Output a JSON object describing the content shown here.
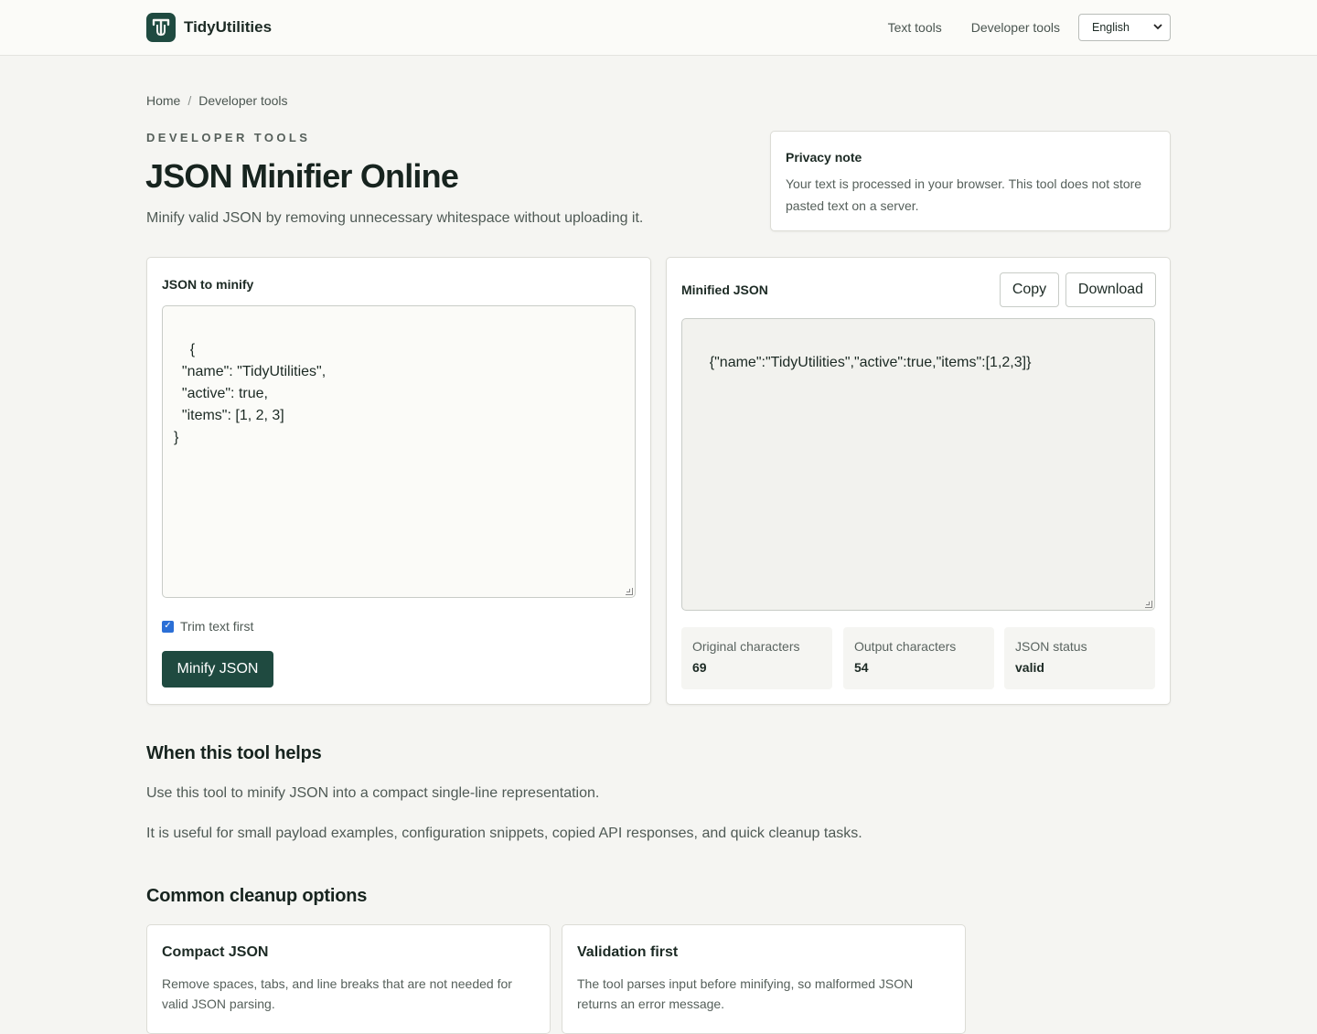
{
  "header": {
    "brand": "TidyUtilities",
    "nav": [
      "Text tools",
      "Developer tools"
    ],
    "language": "English"
  },
  "breadcrumb": [
    "Home",
    "Developer tools"
  ],
  "page": {
    "eyebrow": "DEVELOPER TOOLS",
    "title": "JSON Minifier Online",
    "subtitle": "Minify valid JSON by removing unnecessary whitespace without uploading it."
  },
  "privacy": {
    "title": "Privacy note",
    "text": "Your text is processed in your browser. This tool does not store pasted text on a server."
  },
  "input_panel": {
    "label": "JSON to minify",
    "value": "{\n  \"name\": \"TidyUtilities\",\n  \"active\": true,\n  \"items\": [1, 2, 3]\n}",
    "trim_label": "Trim text first",
    "trim_checked": true,
    "minify_label": "Minify JSON"
  },
  "output_panel": {
    "label": "Minified JSON",
    "copy_label": "Copy",
    "download_label": "Download",
    "value": "{\"name\":\"TidyUtilities\",\"active\":true,\"items\":[1,2,3]}",
    "stats": [
      {
        "label": "Original characters",
        "value": "69"
      },
      {
        "label": "Output characters",
        "value": "54"
      },
      {
        "label": "JSON status",
        "value": "valid"
      }
    ]
  },
  "helps": {
    "heading": "When this tool helps",
    "paragraphs": [
      "Use this tool to minify JSON into a compact single-line representation.",
      "It is useful for small payload examples, configuration snippets, copied API responses, and quick cleanup tasks."
    ]
  },
  "options": {
    "heading": "Common cleanup options",
    "cards": [
      {
        "title": "Compact JSON",
        "text": "Remove spaces, tabs, and line breaks that are not needed for valid JSON parsing."
      },
      {
        "title": "Validation first",
        "text": "The tool parses input before minifying, so malformed JSON returns an error message."
      }
    ]
  },
  "colors": {
    "accent": "#1f4a40",
    "background": "#f5f5f2",
    "checkbox": "#2b6fd6"
  }
}
